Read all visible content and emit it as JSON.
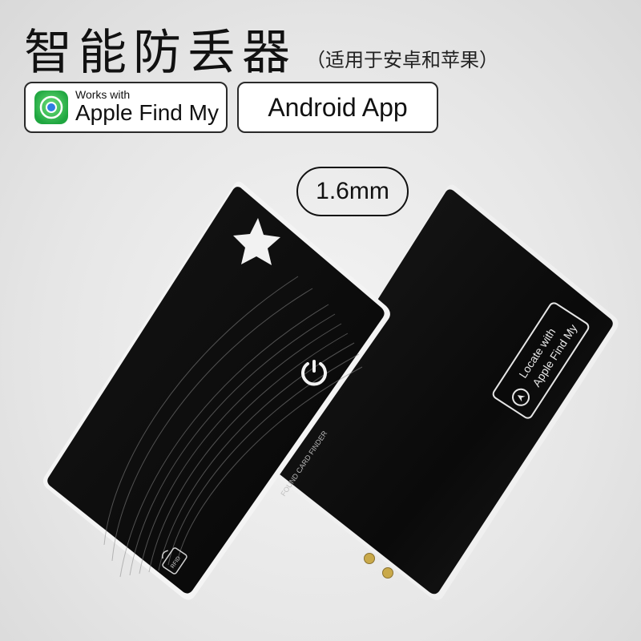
{
  "header": {
    "title": "智能防丢器",
    "subtitle": "（适用于安卓和苹果）"
  },
  "badges": {
    "find_my_small": "Works with",
    "find_my_big": "Apple Find My",
    "android": "Android App"
  },
  "thickness_label": "1.6mm",
  "back_card": {
    "label_line1": "Locate with",
    "label_line2": "Apple Find My"
  },
  "front_card": {
    "rfid_text": "RFID",
    "edge_text": "FOUND CARD FINDER"
  },
  "colors": {
    "card": "#0c0c0c",
    "card_edge": "#f2f2f2",
    "find_my_green": "#3bbf4d",
    "contact_gold": "#c9a94a"
  },
  "icons": [
    "find-my-icon",
    "star-icon",
    "power-icon",
    "rfid-icon",
    "nfc-icon"
  ]
}
